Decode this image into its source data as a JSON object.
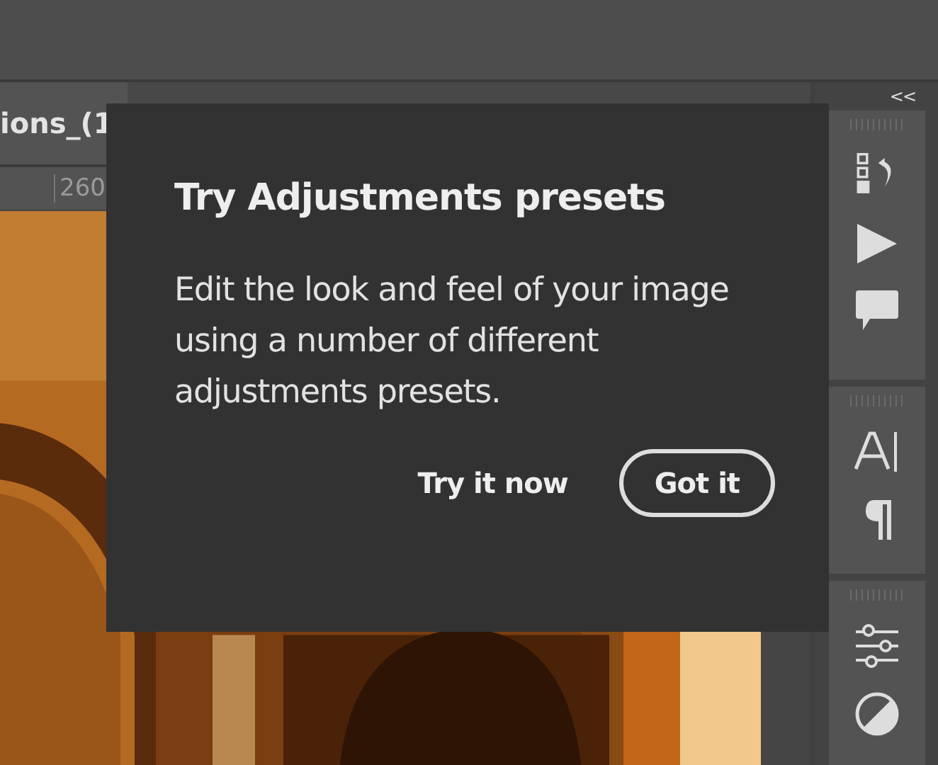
{
  "document_tab": {
    "title": "ions_(1"
  },
  "ruler": {
    "label": "260"
  },
  "panel_dock": {
    "collapse": "<<"
  },
  "popup": {
    "title": "Try Adjustments presets",
    "body": "Edit the look and feel of your image using a number of different adjustments presets.",
    "buttons": [
      {
        "label": "Try it now",
        "kind": "link"
      },
      {
        "label": "Got it",
        "kind": "outlined"
      }
    ]
  }
}
